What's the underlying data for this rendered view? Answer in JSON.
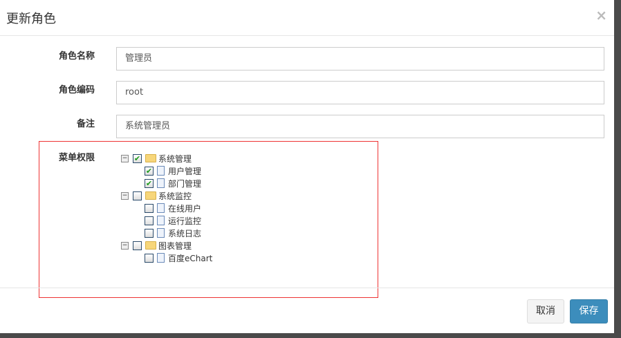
{
  "dialog": {
    "title": "更新角色",
    "close": "×"
  },
  "form": {
    "name_label": "角色名称",
    "name_value": "管理员",
    "code_label": "角色编码",
    "code_value": "root",
    "remark_label": "备注",
    "remark_value": "系统管理员",
    "menu_label": "菜单权限"
  },
  "tree": [
    {
      "label": "系统管理",
      "checked": true,
      "children": [
        {
          "label": "用户管理",
          "checked": true
        },
        {
          "label": "部门管理",
          "checked": true
        }
      ]
    },
    {
      "label": "系统监控",
      "checked": false,
      "children": [
        {
          "label": "在线用户",
          "checked": false
        },
        {
          "label": "运行监控",
          "checked": false
        },
        {
          "label": "系统日志",
          "checked": false
        }
      ]
    },
    {
      "label": "图表管理",
      "checked": false,
      "children": [
        {
          "label": "百度eChart",
          "checked": false
        }
      ]
    }
  ],
  "buttons": {
    "cancel": "取消",
    "save": "保存"
  }
}
